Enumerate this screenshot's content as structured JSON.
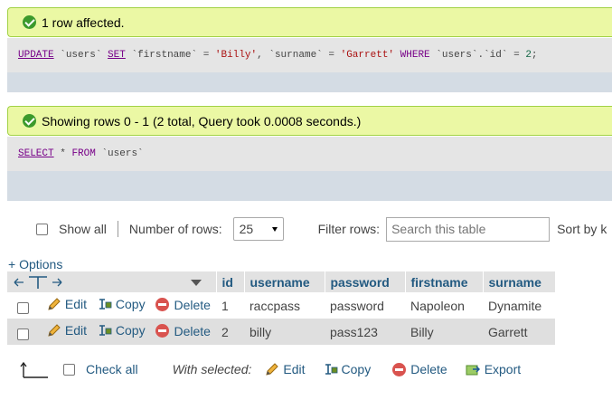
{
  "results": [
    {
      "message": "1 row affected.",
      "sql": {
        "kw_update": "UPDATE",
        "table": "`users`",
        "kw_set": "SET",
        "col1": "`firstname`",
        "eq": "=",
        "val1": "'Billy'",
        "comma": ",",
        "col2": "`surname`",
        "val2": "'Garrett'",
        "kw_where": "WHERE",
        "col3": "`users`.`id`",
        "val3": "2",
        "semi": ";"
      }
    },
    {
      "message": "Showing rows 0 - 1 (2 total, Query took 0.0008 seconds.)",
      "sql": {
        "kw_select": "SELECT",
        "star": "*",
        "kw_from": "FROM",
        "table": "`users`"
      }
    }
  ],
  "navbar": {
    "show_all_label": "Show all",
    "rows_label": "Number of rows:",
    "rows_value": "25",
    "filter_label": "Filter rows:",
    "filter_placeholder": "Search this table",
    "sort_label": "Sort by k"
  },
  "options_label": "+ Options",
  "table": {
    "columns": [
      "id",
      "username",
      "password",
      "firstname",
      "surname"
    ],
    "action_labels": {
      "edit": "Edit",
      "copy": "Copy",
      "delete": "Delete"
    },
    "rows": [
      {
        "id": "1",
        "username": "raccpass",
        "password": "password",
        "firstname": "Napoleon",
        "surname": "Dynamite"
      },
      {
        "id": "2",
        "username": "billy",
        "password": "pass123",
        "firstname": "Billy",
        "surname": "Garrett"
      }
    ]
  },
  "bottom": {
    "check_all": "Check all",
    "with_selected": "With selected:",
    "edit": "Edit",
    "copy": "Copy",
    "delete": "Delete",
    "export": "Export"
  },
  "colors": {
    "success_bg": "#ebf8a4",
    "link": "#235a81",
    "header_bg": "#e2e2e2",
    "even_row_bg": "#dfdfdf"
  }
}
